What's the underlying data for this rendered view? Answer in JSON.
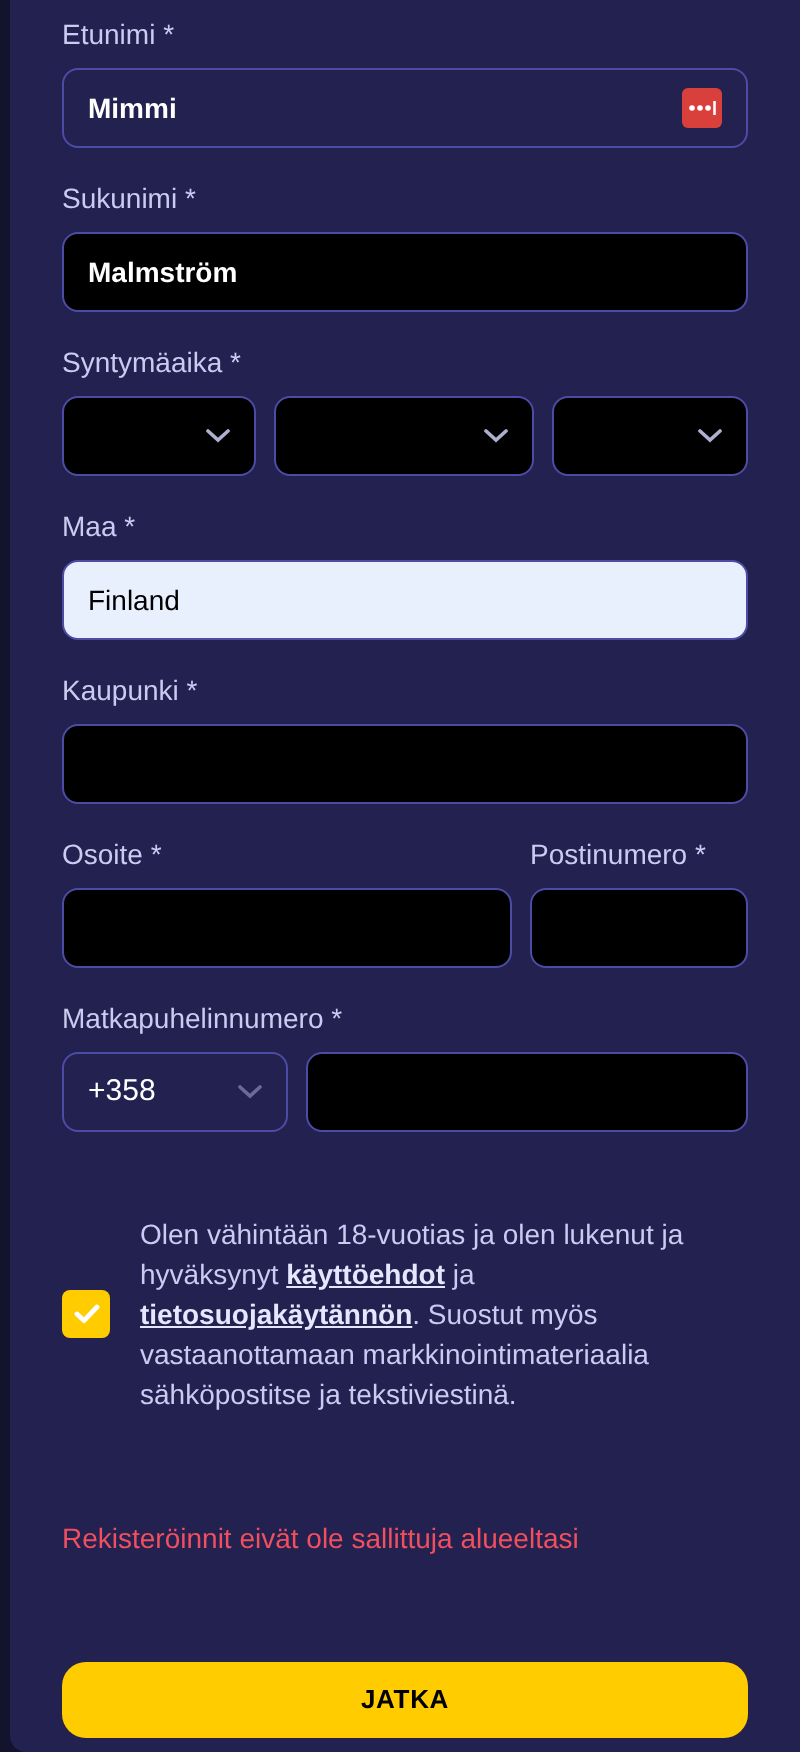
{
  "rows": [
    {
      "columns": [
        {
          "label": "Etunimi *",
          "controls": [
            {
              "kind": "field",
              "value": "Mimmi",
              "password_manager": true
            }
          ]
        }
      ]
    },
    {
      "columns": [
        {
          "label": "Sukunimi *",
          "controls": [
            {
              "kind": "blackfield",
              "value": "Malmström",
              "password_manager": false
            }
          ]
        }
      ]
    },
    {
      "columns": [
        {
          "label": "Syntymäaika *",
          "controls": [
            {
              "kind": "blackselect"
            },
            {
              "kind": "blackselect"
            },
            {
              "kind": "blackselect"
            }
          ]
        }
      ]
    },
    {
      "columns": [
        {
          "label": "Maa *",
          "controls": [
            {
              "kind": "autofilled",
              "value": "Finland",
              "password_manager": false
            }
          ]
        }
      ]
    },
    {
      "columns": [
        {
          "label": "Kaupunki *",
          "controls": [
            {
              "kind": "blackfield",
              "password_manager": false
            }
          ]
        }
      ]
    },
    {
      "columns": [
        {
          "label": "Osoite *",
          "controls": [
            {
              "kind": "blackfield",
              "password_manager": false
            }
          ]
        },
        {
          "label": "Postinumero *",
          "controls": [
            {
              "kind": "blackfield",
              "password_manager": false
            }
          ]
        }
      ]
    },
    {
      "columns": [
        {
          "label": "Matkapuhelinnumero *",
          "controls": [
            {
              "kind": "select",
              "value": "+358"
            },
            {
              "kind": "blackfield",
              "password_manager": false
            }
          ]
        }
      ]
    }
  ],
  "consent": {
    "checked": true,
    "parts": [
      {
        "kind": "text",
        "text": "Olen vähintään 18-vuotias ja olen lukenut ja hyväksynyt "
      },
      {
        "kind": "link",
        "text": "käyttöehdot"
      },
      {
        "kind": "text",
        "text": " ja "
      },
      {
        "kind": "link",
        "text": "tietosuojakäytännön"
      },
      {
        "kind": "text",
        "text": ". Suostut myös vastaanottamaan markkinointimateriaalia sähköpostitse ja tekstiviestinä."
      }
    ]
  },
  "error": "Rekisteröinnit eivät ole sallittuja alueeltasi",
  "submit": "JATKA"
}
